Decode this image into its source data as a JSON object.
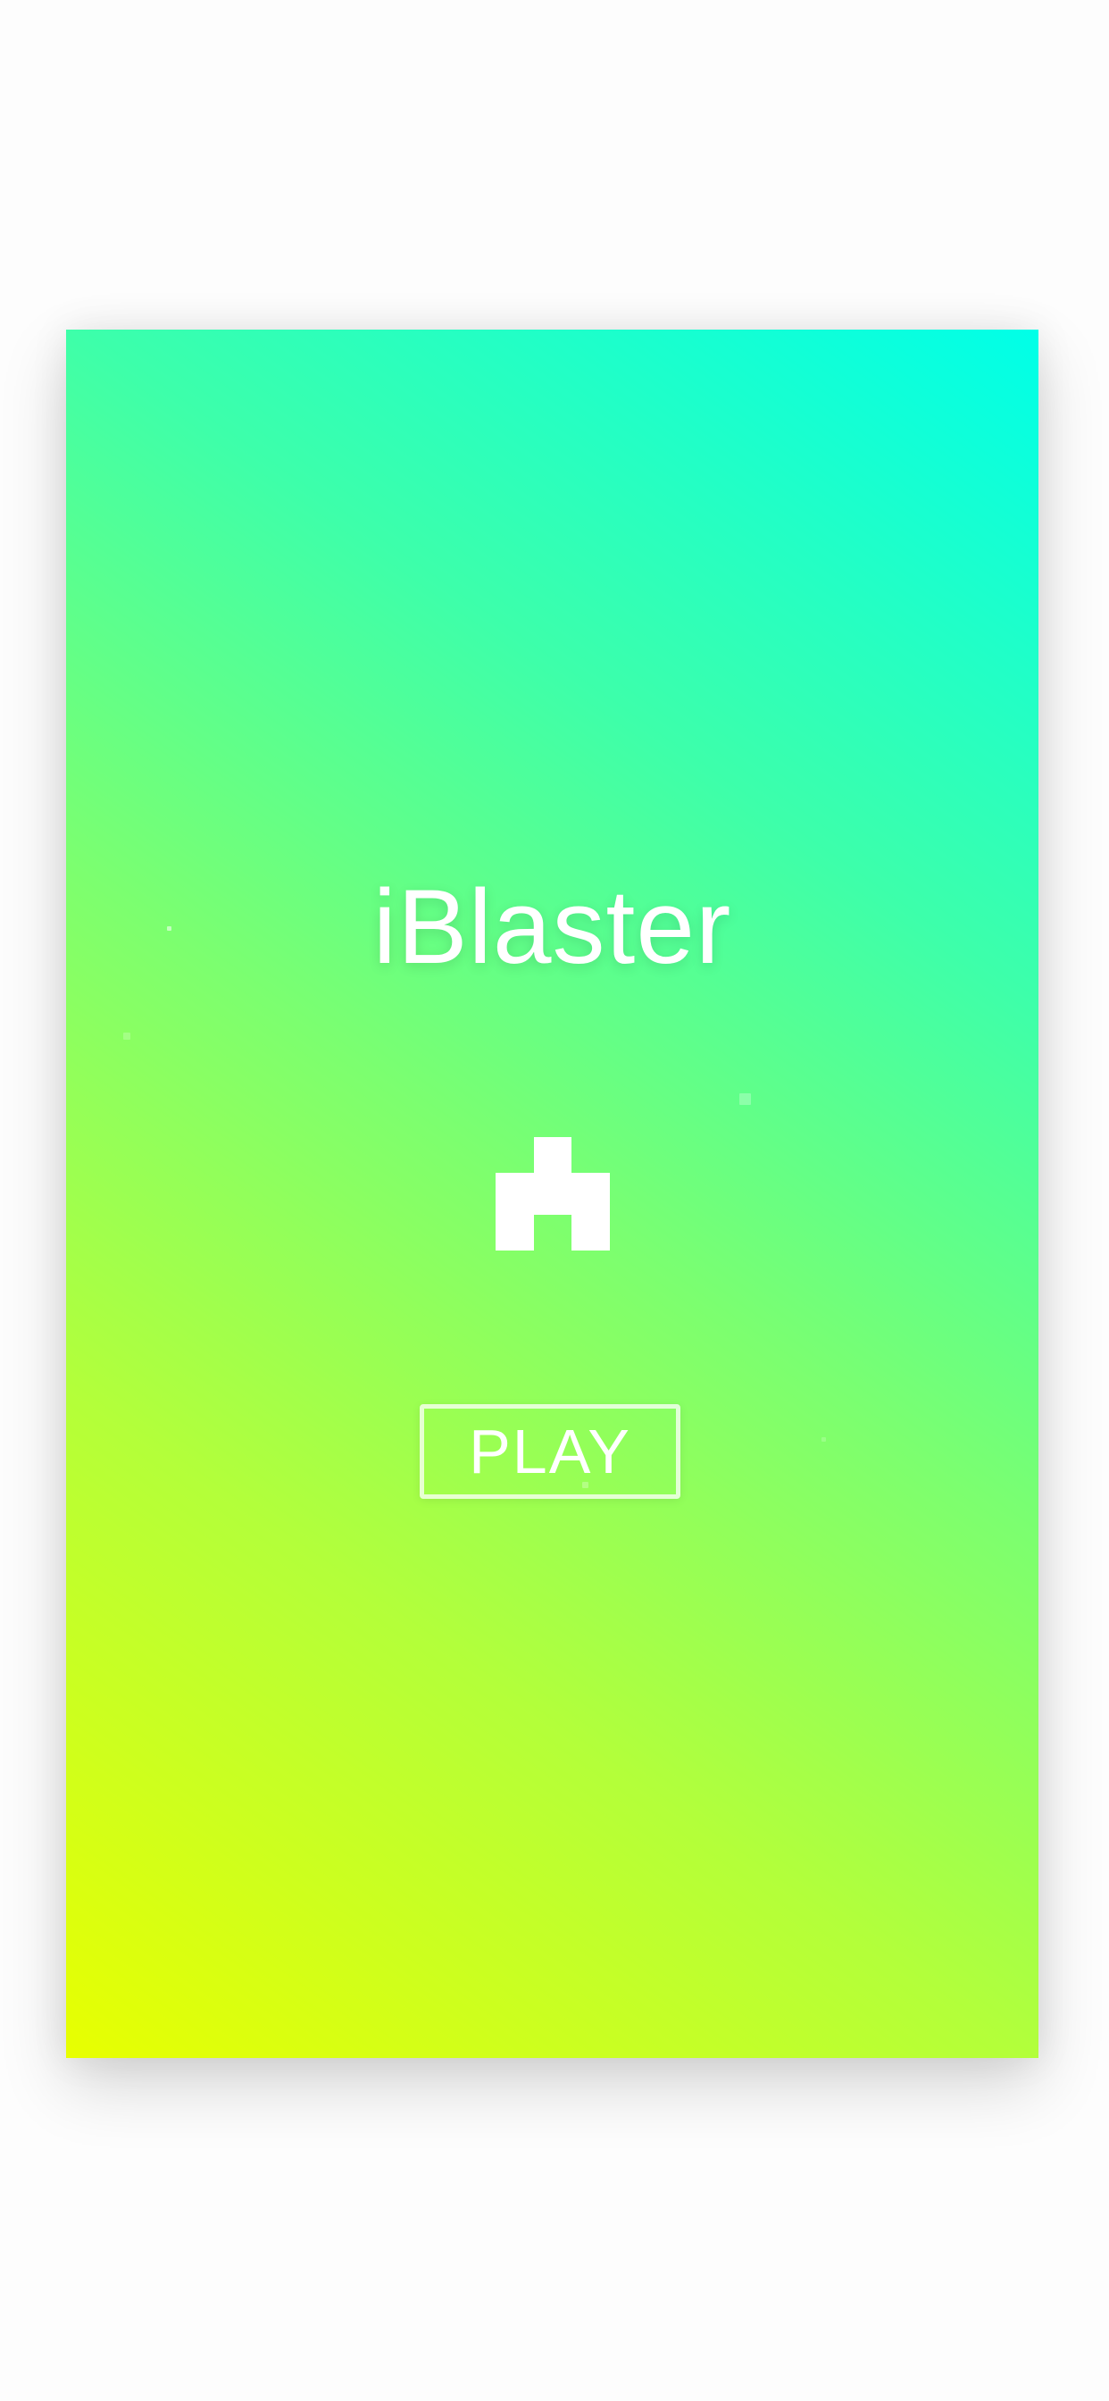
{
  "game": {
    "title": "iBlaster",
    "play_label": "PLAY",
    "ship_icon": "pixel-ship-icon"
  },
  "colors": {
    "background": "#fdfdfd",
    "gradient_top_right": "#00ffe8",
    "gradient_bottom_left": "#e8ff00",
    "foreground": "#ffffff"
  }
}
